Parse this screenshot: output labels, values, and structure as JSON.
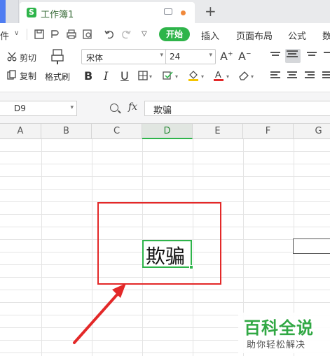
{
  "tab": {
    "title": "工作簿1"
  },
  "menubar": {
    "file_label": "件",
    "start_label": "开始",
    "items": [
      "插入",
      "页面布局",
      "公式",
      "数"
    ]
  },
  "ribbon": {
    "cut": "剪切",
    "copy": "复制",
    "format_painter": "格式刷",
    "font_name": "宋体",
    "font_size": "24"
  },
  "formula_bar": {
    "cell_ref": "D9",
    "fx_label": "fx",
    "content": "欺骗"
  },
  "columns": [
    "A",
    "B",
    "C",
    "D",
    "E",
    "F",
    "G"
  ],
  "active_column": "D",
  "active_cell": {
    "ref": "D9",
    "value": "欺骗"
  },
  "watermark": {
    "main": "百科全说",
    "sub": "助你轻松解决"
  },
  "colors": {
    "accent": "#2eb44a",
    "highlight": "#e32828"
  }
}
